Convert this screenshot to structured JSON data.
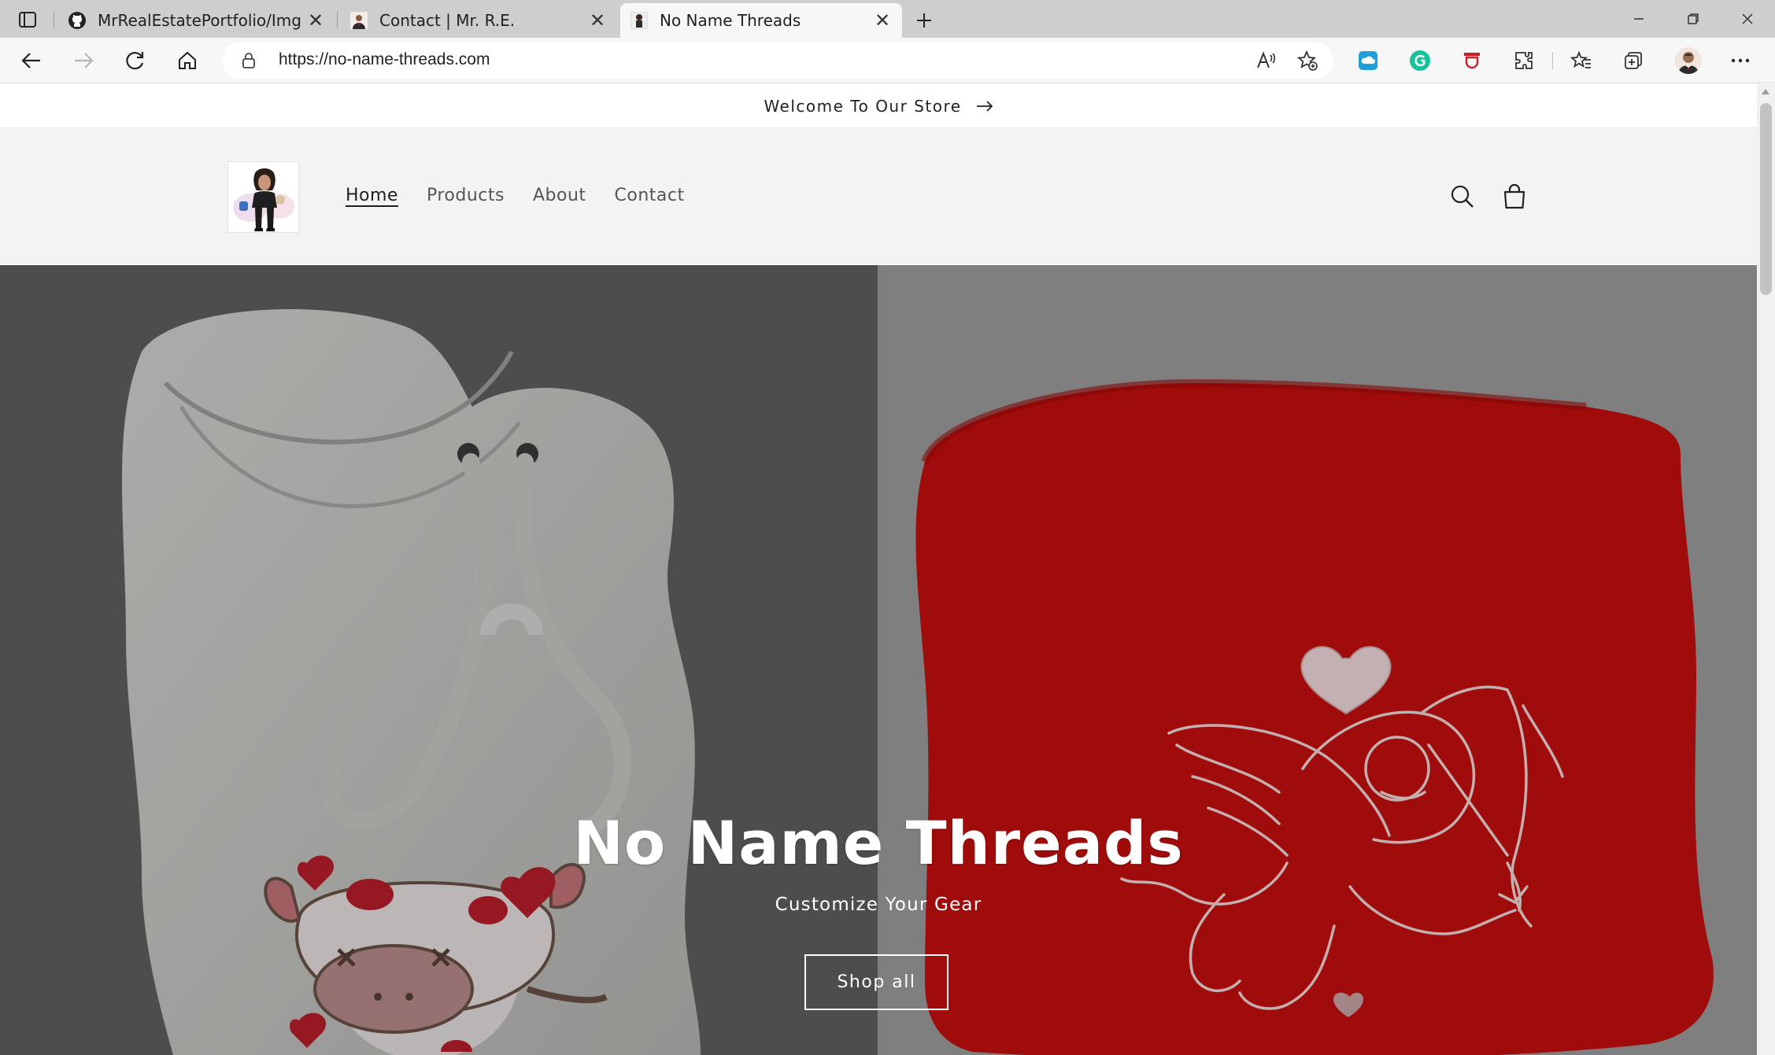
{
  "browser": {
    "tabs": [
      {
        "title": "MrRealEstatePortfolio/Img at ma",
        "favicon": "github-icon"
      },
      {
        "title": "Contact | Mr. R.E.",
        "favicon": "person-photo-icon"
      },
      {
        "title": "No Name Threads",
        "favicon": "store-logo-icon",
        "active": true
      }
    ],
    "url": "https://no-name-threads.com"
  },
  "store": {
    "announcement": "Welcome To Our Store",
    "menu": [
      {
        "label": "Home",
        "active": true
      },
      {
        "label": "Products"
      },
      {
        "label": "About"
      },
      {
        "label": "Contact"
      }
    ],
    "hero": {
      "title": "No Name Threads",
      "subtitle": "Customize Your Gear",
      "button": "Shop all"
    }
  },
  "colors": {
    "hoodie_red": "#c40f0f",
    "hoodie_white": "#e9e9e6",
    "header_bg": "#f3f3f3",
    "grammarly": "#15c39a",
    "tab_bar": "#cecece"
  }
}
